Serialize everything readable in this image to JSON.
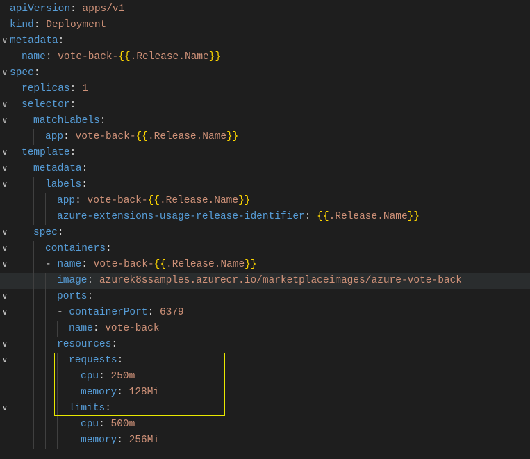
{
  "folds": [
    "",
    "",
    "∨",
    "",
    "∨",
    "",
    "∨",
    "∨",
    "",
    "∨",
    "∨",
    "∨",
    "",
    "",
    "∨",
    "∨",
    "∨",
    "",
    "∨",
    "∨",
    "",
    "∨",
    "∨",
    "",
    "",
    "∨",
    "",
    "",
    ""
  ],
  "lines": {
    "l0": {
      "k": "apiVersion",
      "v": "apps/v1"
    },
    "l1": {
      "k": "kind",
      "v": "Deployment"
    },
    "l2": {
      "k": "metadata"
    },
    "l3": {
      "k": "name",
      "pre": "vote-back-",
      "rel": ".Release.Name"
    },
    "l4": {
      "k": "spec"
    },
    "l5": {
      "k": "replicas",
      "n": "1"
    },
    "l6": {
      "k": "selector"
    },
    "l7": {
      "k": "matchLabels"
    },
    "l8": {
      "k": "app",
      "pre": "vote-back-",
      "rel": ".Release.Name"
    },
    "l9": {
      "k": "template"
    },
    "l10": {
      "k": "metadata"
    },
    "l11": {
      "k": "labels"
    },
    "l12": {
      "k": "app",
      "pre": "vote-back-",
      "rel": ".Release.Name"
    },
    "l13": {
      "k": "azure-extensions-usage-release-identifier",
      "rel": ".Release.Name"
    },
    "l14": {
      "k": "spec"
    },
    "l15": {
      "k": "containers"
    },
    "l16": {
      "dash": "- ",
      "k": "name",
      "pre": "vote-back-",
      "rel": ".Release.Name"
    },
    "l17": {
      "k": "image",
      "v": "azurek8ssamples.azurecr.io/marketplaceimages/azure-vote-back"
    },
    "l18": {
      "k": "ports"
    },
    "l19": {
      "dash": "- ",
      "k": "containerPort",
      "n": "6379"
    },
    "l20": {
      "k": "name",
      "v": "vote-back"
    },
    "l21": {
      "k": "resources"
    },
    "l22": {
      "k": "requests"
    },
    "l23": {
      "k": "cpu",
      "v": "250m"
    },
    "l24": {
      "k": "memory",
      "v": "128Mi"
    },
    "l25": {
      "k": "limits"
    },
    "l26": {
      "k": "cpu",
      "v": "500m"
    },
    "l27": {
      "k": "memory",
      "v": "256Mi"
    }
  },
  "chart_data": {
    "type": "table",
    "title": "Kubernetes Deployment YAML",
    "rows": [
      [
        "apiVersion",
        "apps/v1"
      ],
      [
        "kind",
        "Deployment"
      ],
      [
        "metadata.name",
        "vote-back-{{.Release.Name}}"
      ],
      [
        "spec.replicas",
        1
      ],
      [
        "spec.selector.matchLabels.app",
        "vote-back-{{.Release.Name}}"
      ],
      [
        "spec.template.metadata.labels.app",
        "vote-back-{{.Release.Name}}"
      ],
      [
        "spec.template.metadata.labels.azure-extensions-usage-release-identifier",
        "{{.Release.Name}}"
      ],
      [
        "spec.template.spec.containers[0].name",
        "vote-back-{{.Release.Name}}"
      ],
      [
        "spec.template.spec.containers[0].image",
        "azurek8ssamples.azurecr.io/marketplaceimages/azure-vote-back"
      ],
      [
        "spec.template.spec.containers[0].ports[0].containerPort",
        6379
      ],
      [
        "spec.template.spec.containers[0].ports[0].name",
        "vote-back"
      ],
      [
        "spec.template.spec.containers[0].resources.requests.cpu",
        "250m"
      ],
      [
        "spec.template.spec.containers[0].resources.requests.memory",
        "128Mi"
      ],
      [
        "spec.template.spec.containers[0].resources.limits.cpu",
        "500m"
      ],
      [
        "spec.template.spec.containers[0].resources.limits.memory",
        "256Mi"
      ]
    ]
  }
}
